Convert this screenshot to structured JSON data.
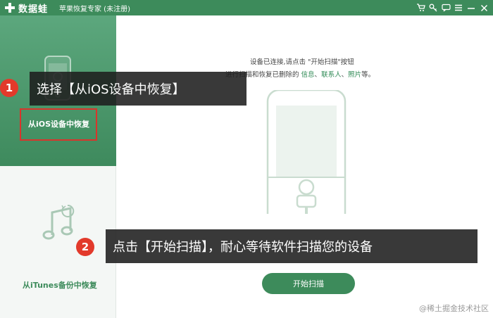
{
  "titlebar": {
    "brand": "数据蛙",
    "subtitle": "苹果恢复专家 (未注册)",
    "icons": [
      "cart-icon",
      "key-icon",
      "chat-icon",
      "menu-icon",
      "minimize-icon",
      "close-icon"
    ]
  },
  "sidebar": {
    "items": [
      {
        "label": "从iOS设备中恢复",
        "icon": "phone-icon"
      },
      {
        "label": "从iTunes备份中恢复",
        "icon": "music-note-icon"
      }
    ]
  },
  "main": {
    "hint_line1": "设备已连接,请点击 \"开始扫描\"按钮",
    "hint_line2_prefix": "进行扫描和恢复已删除的 ",
    "hint_link_info": "信息",
    "hint_sep1": "、",
    "hint_link_contacts": "联系人",
    "hint_sep2": "、",
    "hint_link_photos": "照片",
    "hint_line2_suffix": "等。",
    "start_button": "开始扫描"
  },
  "annotations": {
    "step1_number": "1",
    "step1_text": "选择【从iOS设备中恢复】",
    "step2_number": "2",
    "step2_text": "点击【开始扫描】，耐心等待软件扫描您的设备"
  },
  "watermark": "@稀土掘金技术社区",
  "colors": {
    "brand_green": "#3d8b5b",
    "highlight_red": "#d9342b",
    "step_red": "#e23a2b"
  }
}
